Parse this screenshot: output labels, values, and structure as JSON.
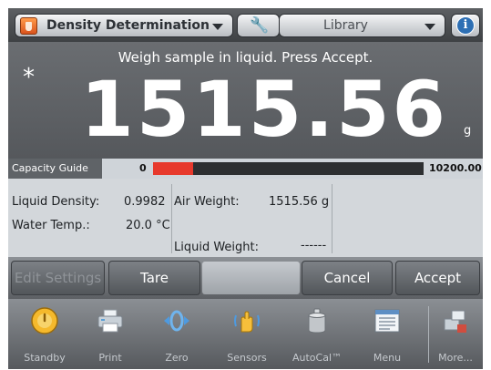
{
  "header": {
    "app_name": "Density Determination",
    "library_label": "Library"
  },
  "display": {
    "instruction": "Weigh sample in liquid. Press Accept.",
    "stability_marker": "*",
    "weight": "1515.56",
    "unit": "g"
  },
  "capacity": {
    "label": "Capacity Guide",
    "min": "0",
    "max": "10200.00",
    "fill_fraction": 0.149
  },
  "info": {
    "liquid_density_label": "Liquid Density:",
    "liquid_density_value": "0.9982",
    "water_temp_label": "Water Temp.:",
    "water_temp_value": "20.0 °C",
    "air_weight_label": "Air Weight:",
    "air_weight_value": "1515.56 g",
    "liquid_weight_label": "Liquid Weight:",
    "liquid_weight_value": "------"
  },
  "buttons": {
    "edit_settings": "Edit Settings",
    "tare": "Tare",
    "cancel": "Cancel",
    "accept": "Accept"
  },
  "toolbar": {
    "items": [
      {
        "label": "Standby",
        "icon": "standby-icon"
      },
      {
        "label": "Print",
        "icon": "printer-icon"
      },
      {
        "label": "Zero",
        "icon": "zero-icon"
      },
      {
        "label": "Sensors",
        "icon": "hand-sensor-icon"
      },
      {
        "label": "AutoCal™",
        "icon": "calibration-weight-icon"
      },
      {
        "label": "Menu",
        "icon": "menu-icon"
      },
      {
        "label": "More...",
        "icon": "more-icon"
      }
    ]
  },
  "colors": {
    "capacity_fill": "#e7392c",
    "app_icon": "#e9692c",
    "info_icon": "#2d6fb4"
  }
}
